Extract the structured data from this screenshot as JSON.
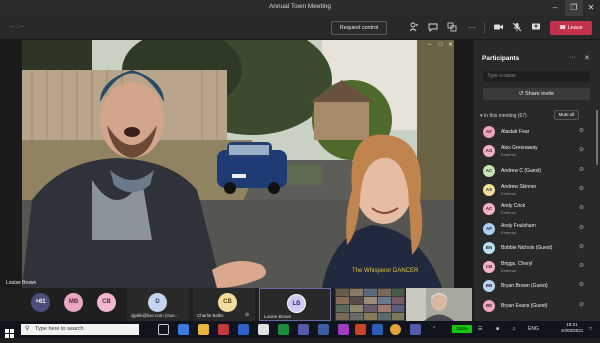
{
  "window": {
    "title": "Annual Town Meeting",
    "timer": "--:--"
  },
  "toolbar": {
    "request_control": "Request control",
    "leave": "Leave"
  },
  "video": {
    "speaker_name": "Louise Brown"
  },
  "strip": {
    "overflow_count": "+61",
    "avatars": [
      {
        "initials": "MB",
        "color": "#e9a6c0"
      },
      {
        "initials": "CB",
        "color": "#f2b8d0"
      }
    ],
    "tiles": [
      {
        "initials": "D",
        "color": "#c7d4ee",
        "name": "djpikk@live.com (Gue..."
      },
      {
        "initials": "CB",
        "color": "#f3dd9c",
        "name": "Charlie Bolks"
      },
      {
        "initials": "LB",
        "color": "#d0c8ef",
        "name": "Louise Brown"
      }
    ]
  },
  "panel": {
    "title": "Participants",
    "search_placeholder": "Type a name",
    "share_invite": "Share invite",
    "section": "In this meeting (67)",
    "mute_all": "Mute all",
    "participants": [
      {
        "initials": "AF",
        "color": "#f0a3b8",
        "name": "Alastair Fear",
        "sub": ""
      },
      {
        "initials": "AG",
        "color": "#f5b0c4",
        "name": "Alex Greenaway",
        "sub": "External"
      },
      {
        "initials": "AC",
        "color": "#c9e5b5",
        "name": "Andrew C (Guest)",
        "sub": ""
      },
      {
        "initials": "AS",
        "color": "#f3e19b",
        "name": "Andrew Skinner",
        "sub": "External"
      },
      {
        "initials": "AC",
        "color": "#f6b3c4",
        "name": "Andy Crick",
        "sub": "External"
      },
      {
        "initials": "AF",
        "color": "#a9d0f0",
        "name": "Andy Foulsham",
        "sub": "External"
      },
      {
        "initials": "BN",
        "color": "#b8e0ef",
        "name": "Bobbie Nichols (Guest)",
        "sub": ""
      },
      {
        "initials": "CB",
        "color": "#f7b4c7",
        "name": "Briggs, Cheryl",
        "sub": "External"
      },
      {
        "initials": "BB",
        "color": "#b6d6f2",
        "name": "Bryan Brown (Guest)",
        "sub": ""
      },
      {
        "initials": "BE",
        "color": "#f0a7bb",
        "name": "Bryan Evans (Guest)",
        "sub": ""
      }
    ]
  },
  "taskbar": {
    "search_text": "Type here to search",
    "battery": "100%",
    "lang": "ENG",
    "time": "19:21",
    "date": "10/03/2021"
  }
}
